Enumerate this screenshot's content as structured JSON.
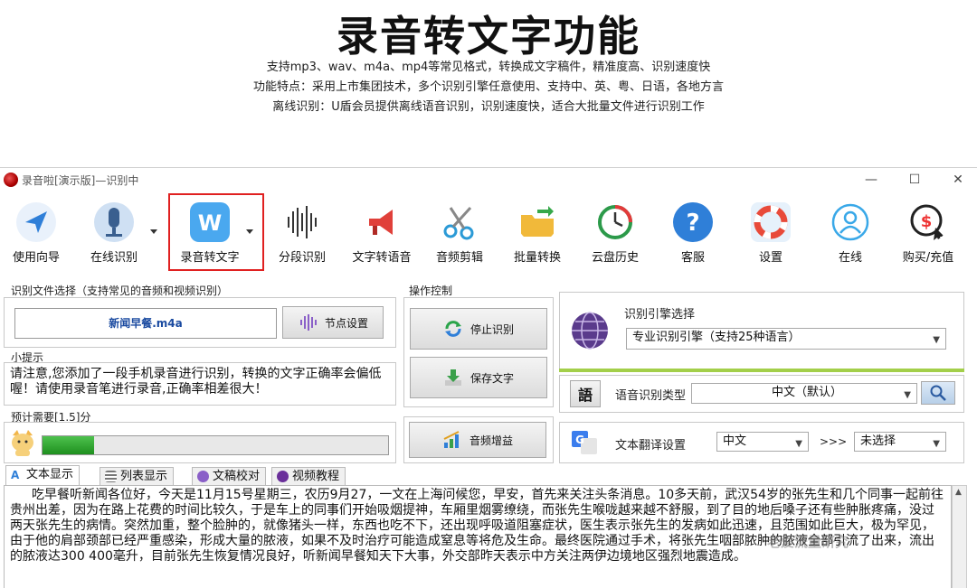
{
  "promo": {
    "title": "录音转文字功能",
    "line1": "支持mp3、wav、m4a、mp4等常见格式，转换成文字稿件，精准度高、识别速度快",
    "line2": "功能特点：采用上市集团技术，多个识别引擎任意使用、支持中、英、粤、日语，各地方言",
    "line3": "离线识别：U盾会员提供离线语音识别，识别速度快，适合大批量文件进行识别工作"
  },
  "window": {
    "title": "录音啦[演示版]—识别中",
    "minimize": "—",
    "maximize": "☐",
    "close": "✕"
  },
  "toolbar": {
    "items": [
      {
        "label": "使用向导"
      },
      {
        "label": "在线识别"
      },
      {
        "label": "录音转文字"
      },
      {
        "label": "分段识别"
      },
      {
        "label": "文字转语音"
      },
      {
        "label": "音频剪辑"
      },
      {
        "label": "批量转换"
      },
      {
        "label": "云盘历史"
      },
      {
        "label": "客服"
      },
      {
        "label": "设置"
      },
      {
        "label": "在线"
      },
      {
        "label": "购买/充值"
      }
    ],
    "w_glyph": "W",
    "help_glyph": "?",
    "money_glyph": "$"
  },
  "file_section": {
    "label": "识别文件选择（支持常见的音频和视频识别）",
    "filename": "新闻早餐.m4a",
    "node_button": "节点设置"
  },
  "tips": {
    "label": "小提示",
    "text": "请注意,您添加了一段手机录音进行识别，转换的文字正确率会偏低喔！请使用录音笔进行录音,正确率相差很大！"
  },
  "estimate": {
    "label": "预计需要[1.5]分",
    "progress": 0.15
  },
  "operation": {
    "label": "操作控制",
    "stop_button": "停止识别",
    "save_button": "保存文字",
    "enhance_button": "音频增益"
  },
  "engine": {
    "label": "识别引擎选择",
    "selected": "专业识别引擎（支持25种语言）"
  },
  "language": {
    "icon_glyph": "語",
    "label": "语音识别类型",
    "selected": "中文（默认）"
  },
  "translate": {
    "label": "文本翻译设置",
    "from": "中文",
    "arrows": ">>>",
    "to": "未选择"
  },
  "tabs": [
    {
      "label": "文本显示"
    },
    {
      "label": "列表显示"
    },
    {
      "label": "文稿校对"
    },
    {
      "label": "视频教程"
    }
  ],
  "transcript": "吃早餐听新闻各位好，今天是11月15号星期三，农历9月27，一文在上海问候您，早安，首先来关注头条消息。10多天前，武汉54岁的张先生和几个同事一起前往贵州出差，因为在路上花费的时间比较久，于是车上的同事们开始吸烟提神，车厢里烟雾缭绕，而张先生喉咙越来越不舒服，到了目的地后嗓子还有些肿胀疼痛，没过两天张先生的病情。突然加重，整个脸肿的，就像猪头一样，东西也吃不下，还出现呼吸道阻塞症状，医生表示张先生的发病如此迅速，且范围如此巨大，极为罕见，由于他的肩部颈部已经严重感染，形成大量的脓液，如果不及时治疗可能造成窒息等将危及生命。最终医院通过手术，将张先生咽部脓肿的脓液全部引流了出来，流出的脓液达300 400毫升，目前张先生恢复情况良好，听新闻早餐知天下大事，外交部昨天表示中方关注两伊边境地区强烈地震造成。",
  "watermark": "老爱流量研究",
  "colors": {
    "highlight": "#e02020",
    "progress": "#2ea02e",
    "accent_blue": "#2f7fd8"
  }
}
